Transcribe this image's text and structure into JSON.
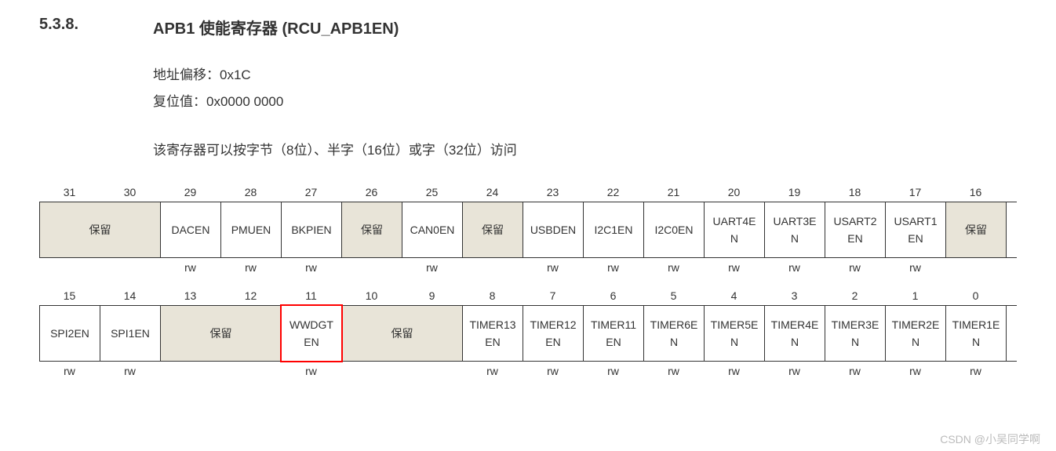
{
  "section_number": "5.3.8.",
  "section_title": "APB1 使能寄存器  (RCU_APB1EN)",
  "address_offset_label": "地址偏移：",
  "address_offset_value": "0x1C",
  "reset_value_label": "复位值：",
  "reset_value_value": "0x0000 0000",
  "description": "该寄存器可以按字节（8位）、半字（16位）或字（32位）访问",
  "row1": {
    "bits": [
      "31",
      "30",
      "29",
      "28",
      "27",
      "26",
      "25",
      "24",
      "23",
      "22",
      "21",
      "20",
      "19",
      "18",
      "17",
      "16"
    ],
    "fields": [
      {
        "name": "保留",
        "span": 2,
        "reserved": true,
        "access": ""
      },
      {
        "name": "DACEN",
        "span": 1,
        "reserved": false,
        "access": "rw"
      },
      {
        "name": "PMUEN",
        "span": 1,
        "reserved": false,
        "access": "rw"
      },
      {
        "name": "BKPIEN",
        "span": 1,
        "reserved": false,
        "access": "rw"
      },
      {
        "name": "保留",
        "span": 1,
        "reserved": true,
        "access": ""
      },
      {
        "name": "CAN0EN",
        "span": 1,
        "reserved": false,
        "access": "rw"
      },
      {
        "name": "保留",
        "span": 1,
        "reserved": true,
        "access": ""
      },
      {
        "name": "USBDEN",
        "span": 1,
        "reserved": false,
        "access": "rw"
      },
      {
        "name": "I2C1EN",
        "span": 1,
        "reserved": false,
        "access": "rw"
      },
      {
        "name": "I2C0EN",
        "span": 1,
        "reserved": false,
        "access": "rw"
      },
      {
        "name": "UART4EN",
        "span": 1,
        "reserved": false,
        "access": "rw"
      },
      {
        "name": "UART3EN",
        "span": 1,
        "reserved": false,
        "access": "rw"
      },
      {
        "name": "USART2EN",
        "span": 1,
        "reserved": false,
        "access": "rw"
      },
      {
        "name": "USART1EN",
        "span": 1,
        "reserved": false,
        "access": "rw"
      },
      {
        "name": "保留",
        "span": 1,
        "reserved": true,
        "access": ""
      }
    ]
  },
  "row2": {
    "bits": [
      "15",
      "14",
      "13",
      "12",
      "11",
      "10",
      "9",
      "8",
      "7",
      "6",
      "5",
      "4",
      "3",
      "2",
      "1",
      "0"
    ],
    "fields": [
      {
        "name": "SPI2EN",
        "span": 1,
        "reserved": false,
        "access": "rw"
      },
      {
        "name": "SPI1EN",
        "span": 1,
        "reserved": false,
        "access": "rw"
      },
      {
        "name": "保留",
        "span": 2,
        "reserved": true,
        "access": ""
      },
      {
        "name": "WWDGTEN",
        "span": 1,
        "reserved": false,
        "access": "rw",
        "highlight": true
      },
      {
        "name": "保留",
        "span": 2,
        "reserved": true,
        "access": ""
      },
      {
        "name": "TIMER13EN",
        "span": 1,
        "reserved": false,
        "access": "rw"
      },
      {
        "name": "TIMER12EN",
        "span": 1,
        "reserved": false,
        "access": "rw"
      },
      {
        "name": "TIMER11EN",
        "span": 1,
        "reserved": false,
        "access": "rw"
      },
      {
        "name": "TIMER6EN",
        "span": 1,
        "reserved": false,
        "access": "rw"
      },
      {
        "name": "TIMER5EN",
        "span": 1,
        "reserved": false,
        "access": "rw"
      },
      {
        "name": "TIMER4EN",
        "span": 1,
        "reserved": false,
        "access": "rw"
      },
      {
        "name": "TIMER3EN",
        "span": 1,
        "reserved": false,
        "access": "rw"
      },
      {
        "name": "TIMER2EN",
        "span": 1,
        "reserved": false,
        "access": "rw"
      },
      {
        "name": "TIMER1EN",
        "span": 1,
        "reserved": false,
        "access": "rw"
      }
    ]
  },
  "watermark": "CSDN @小吴同学啊"
}
